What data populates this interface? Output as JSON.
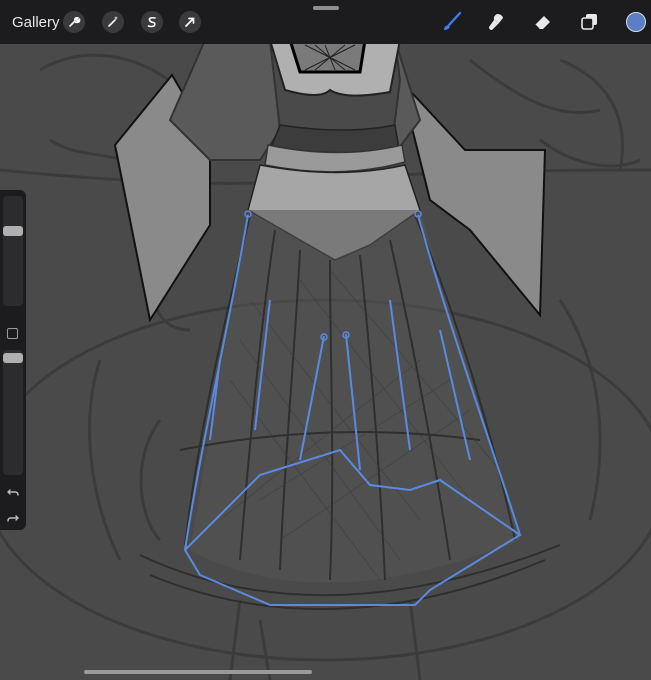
{
  "toolbar": {
    "gallery_label": "Gallery",
    "actions": [
      {
        "name": "actions-wrench",
        "icon": "wrench-icon"
      },
      {
        "name": "adjustments",
        "icon": "magic-wand-icon"
      },
      {
        "name": "selection",
        "icon": "selection-s-icon"
      },
      {
        "name": "transform",
        "icon": "arrow-cursor-icon"
      }
    ],
    "tools": [
      {
        "name": "brush",
        "icon": "brush-icon",
        "active": true
      },
      {
        "name": "smudge",
        "icon": "smudge-icon",
        "active": false
      },
      {
        "name": "eraser",
        "icon": "eraser-icon",
        "active": false
      },
      {
        "name": "layers",
        "icon": "layers-icon",
        "active": false
      }
    ],
    "current_color": "#5b7fc4"
  },
  "sidebar": {
    "brush_size_level": 0.7,
    "opacity_level": 0.97
  },
  "colors": {
    "accent": "#3d7bf0",
    "stroke_blue": "#5a8ae0",
    "chrome": "#1c1c1e",
    "canvas": "#4a4a4a"
  }
}
